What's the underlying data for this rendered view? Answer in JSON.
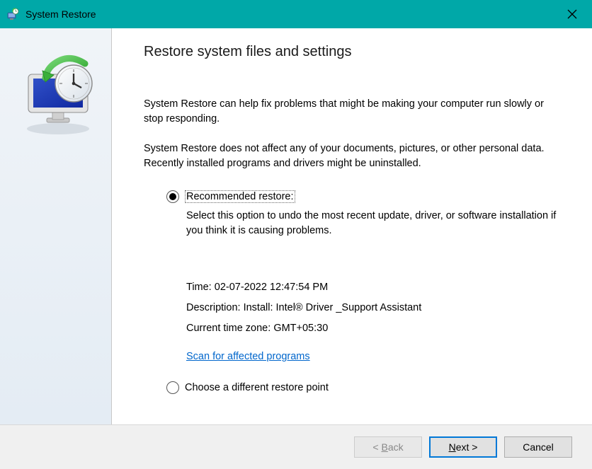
{
  "titlebar": {
    "title": "System Restore"
  },
  "main": {
    "heading": "Restore system files and settings",
    "para1": "System Restore can help fix problems that might be making your computer run slowly or stop responding.",
    "para2": "System Restore does not affect any of your documents, pictures, or other personal data. Recently installed programs and drivers might be uninstalled.",
    "recommended": {
      "label": "Recommended restore:",
      "desc": "Select this option to undo the most recent update, driver, or software installation if you think it is causing problems.",
      "time_label": "Time:",
      "time_value": "02-07-2022 12:47:54 PM",
      "desc_label": "Description:",
      "desc_value": "Install: Intel® Driver _Support Assistant",
      "tz_label": "Current time zone:",
      "tz_value": "GMT+05:30",
      "scan_link": "Scan for affected programs"
    },
    "alt": {
      "label": "Choose a different restore point"
    }
  },
  "footer": {
    "back": "< Back",
    "next": "Next >",
    "cancel": "Cancel"
  }
}
